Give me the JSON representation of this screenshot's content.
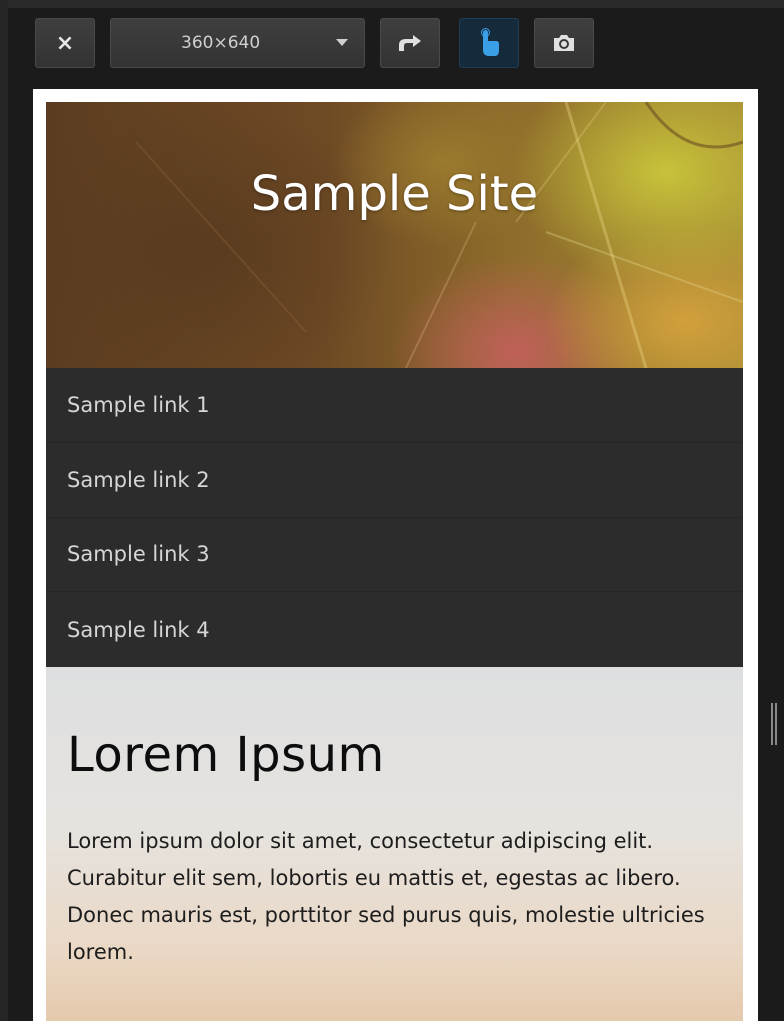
{
  "toolbar": {
    "close_label": "×",
    "device_size": "360×640",
    "rotate_icon": "rotate-icon",
    "touch_icon": "touch-icon",
    "screenshot_icon": "camera-icon",
    "touch_active_color": "#3a9fe6"
  },
  "site": {
    "title": "Sample Site",
    "nav": [
      {
        "label": "Sample link 1"
      },
      {
        "label": "Sample link 2"
      },
      {
        "label": "Sample link 3"
      },
      {
        "label": "Sample link 4"
      }
    ],
    "heading": "Lorem Ipsum",
    "paragraph": "Lorem ipsum dolor sit amet, consectetur adipiscing elit. Curabitur elit sem, lobortis eu mattis et, egestas ac libero. Donec mauris est, porttitor sed purus quis, molestie ultricies lorem."
  }
}
